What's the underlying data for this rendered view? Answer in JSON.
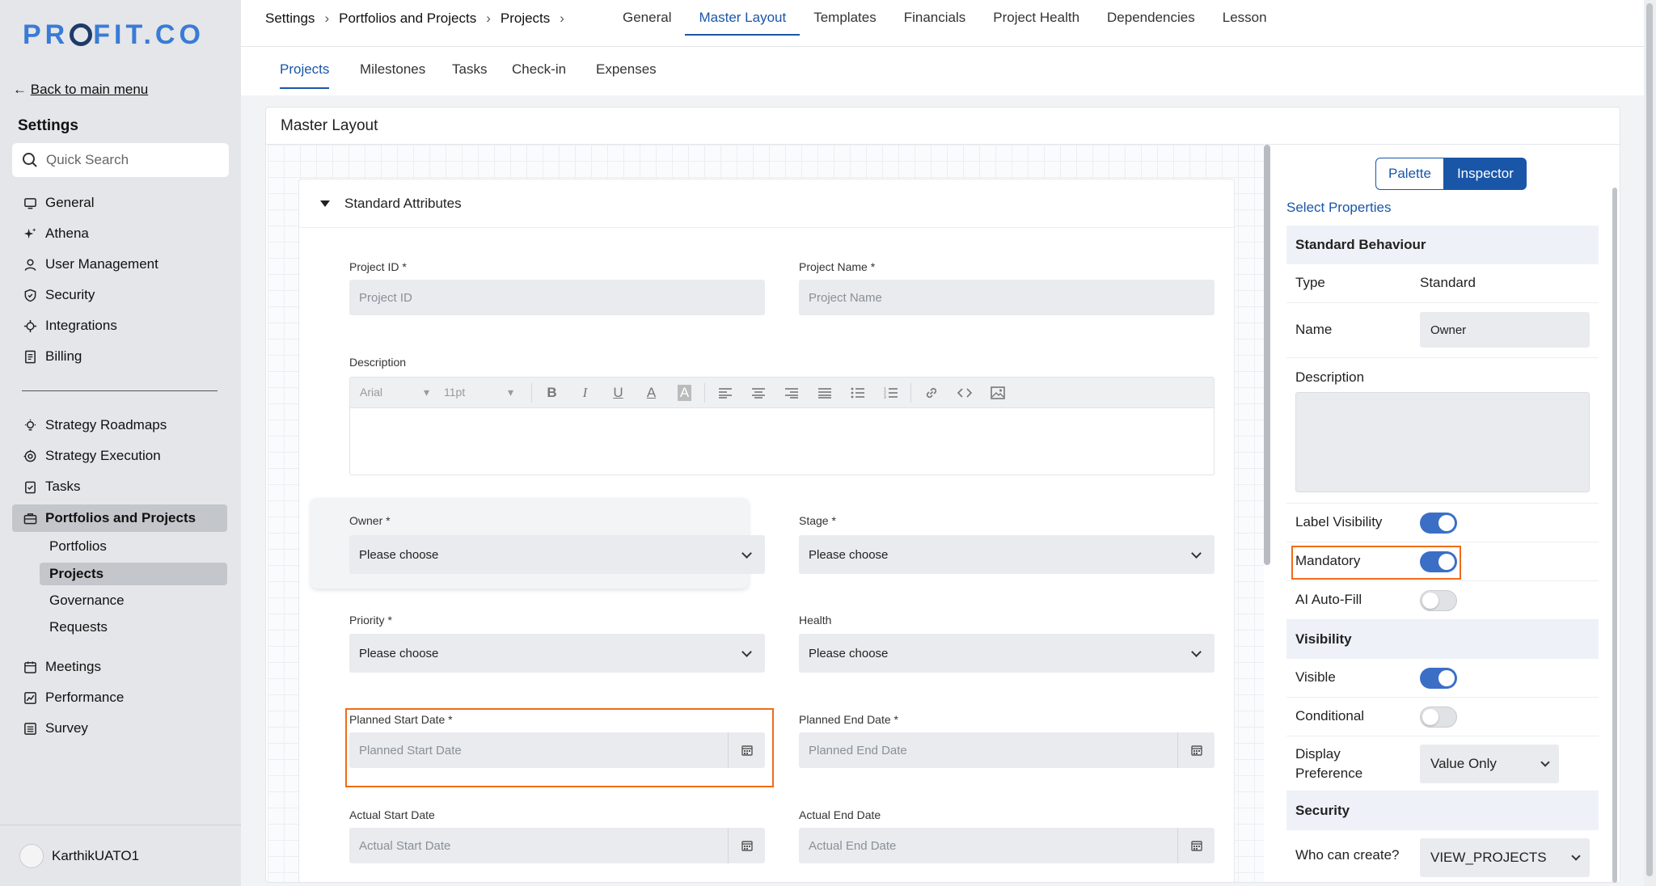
{
  "brand": {
    "logo_before": "PR",
    "logo_after": "FIT.CO"
  },
  "sidebar": {
    "back_label": "Back to main menu",
    "title": "Settings",
    "search_placeholder": "Quick Search",
    "items_top": [
      {
        "label": "General",
        "icon": "monitor-icon"
      },
      {
        "label": "Athena",
        "icon": "sparkle-icon"
      },
      {
        "label": "User Management",
        "icon": "user-icon"
      },
      {
        "label": "Security",
        "icon": "shield-icon"
      },
      {
        "label": "Integrations",
        "icon": "integration-icon"
      },
      {
        "label": "Billing",
        "icon": "receipt-icon"
      }
    ],
    "items_bottom": [
      {
        "label": "Strategy Roadmaps",
        "icon": "bulb-icon"
      },
      {
        "label": "Strategy Execution",
        "icon": "target-icon"
      },
      {
        "label": "Tasks",
        "icon": "clipboard-icon"
      },
      {
        "label": "Portfolios and Projects",
        "icon": "briefcase-icon"
      }
    ],
    "sub_items": [
      "Portfolios",
      "Projects",
      "Governance",
      "Requests"
    ],
    "items_more": [
      {
        "label": "Meetings",
        "icon": "calendar-icon"
      },
      {
        "label": "Performance",
        "icon": "chart-icon"
      },
      {
        "label": "Survey",
        "icon": "list-icon"
      }
    ],
    "user_name": "KarthikUATO1"
  },
  "breadcrumb": {
    "items": [
      "Settings",
      "Portfolios and Projects",
      "Projects"
    ],
    "sep": "›"
  },
  "top_tabs": [
    "General",
    "Master Layout",
    "Templates",
    "Financials",
    "Project Health",
    "Dependencies",
    "Lesson"
  ],
  "top_tab_active": "Master Layout",
  "sub_tabs": [
    "Projects",
    "Milestones",
    "Tasks",
    "Check-in",
    "Expenses"
  ],
  "sub_tab_active": "Projects",
  "panel": {
    "title": "Master Layout"
  },
  "section": {
    "title": "Standard Attributes"
  },
  "form": {
    "project_id": {
      "label": "Project ID *",
      "placeholder": "Project ID"
    },
    "project_name": {
      "label": "Project Name *",
      "placeholder": "Project Name"
    },
    "description": {
      "label": "Description",
      "font": "Arial",
      "size": "11pt"
    },
    "owner": {
      "label": "Owner *",
      "value": "Please choose"
    },
    "stage": {
      "label": "Stage *",
      "value": "Please choose"
    },
    "priority": {
      "label": "Priority *",
      "value": "Please choose"
    },
    "health": {
      "label": "Health",
      "value": "Please choose"
    },
    "planned_start": {
      "label": "Planned Start Date *",
      "placeholder": "Planned Start Date"
    },
    "planned_end": {
      "label": "Planned End Date *",
      "placeholder": "Planned End Date"
    },
    "actual_start": {
      "label": "Actual Start Date",
      "placeholder": "Actual Start Date"
    },
    "actual_end": {
      "label": "Actual End Date",
      "placeholder": "Actual End Date"
    }
  },
  "inspector": {
    "palette_label": "Palette",
    "inspector_label": "Inspector",
    "select_properties": "Select Properties",
    "standard_behaviour": "Standard Behaviour",
    "type_label": "Type",
    "type_value": "Standard",
    "name_label": "Name",
    "name_value": "Owner",
    "description_label": "Description",
    "label_visibility": {
      "label": "Label Visibility",
      "on": true
    },
    "mandatory": {
      "label": "Mandatory",
      "on": true
    },
    "ai_autofill": {
      "label": "AI Auto-Fill",
      "on": false
    },
    "visibility_header": "Visibility",
    "visible": {
      "label": "Visible",
      "on": true
    },
    "conditional": {
      "label": "Conditional",
      "on": false
    },
    "display_pref_label_1": "Display",
    "display_pref_label_2": "Preference",
    "display_pref_value": "Value Only",
    "security_header": "Security",
    "who_can_create_label": "Who can create?",
    "who_can_create_value": "VIEW_PROJECTS"
  },
  "colors": {
    "accent": "#1a56a8",
    "highlight": "#ef6c1a",
    "switch_on": "#3b6fc6"
  }
}
